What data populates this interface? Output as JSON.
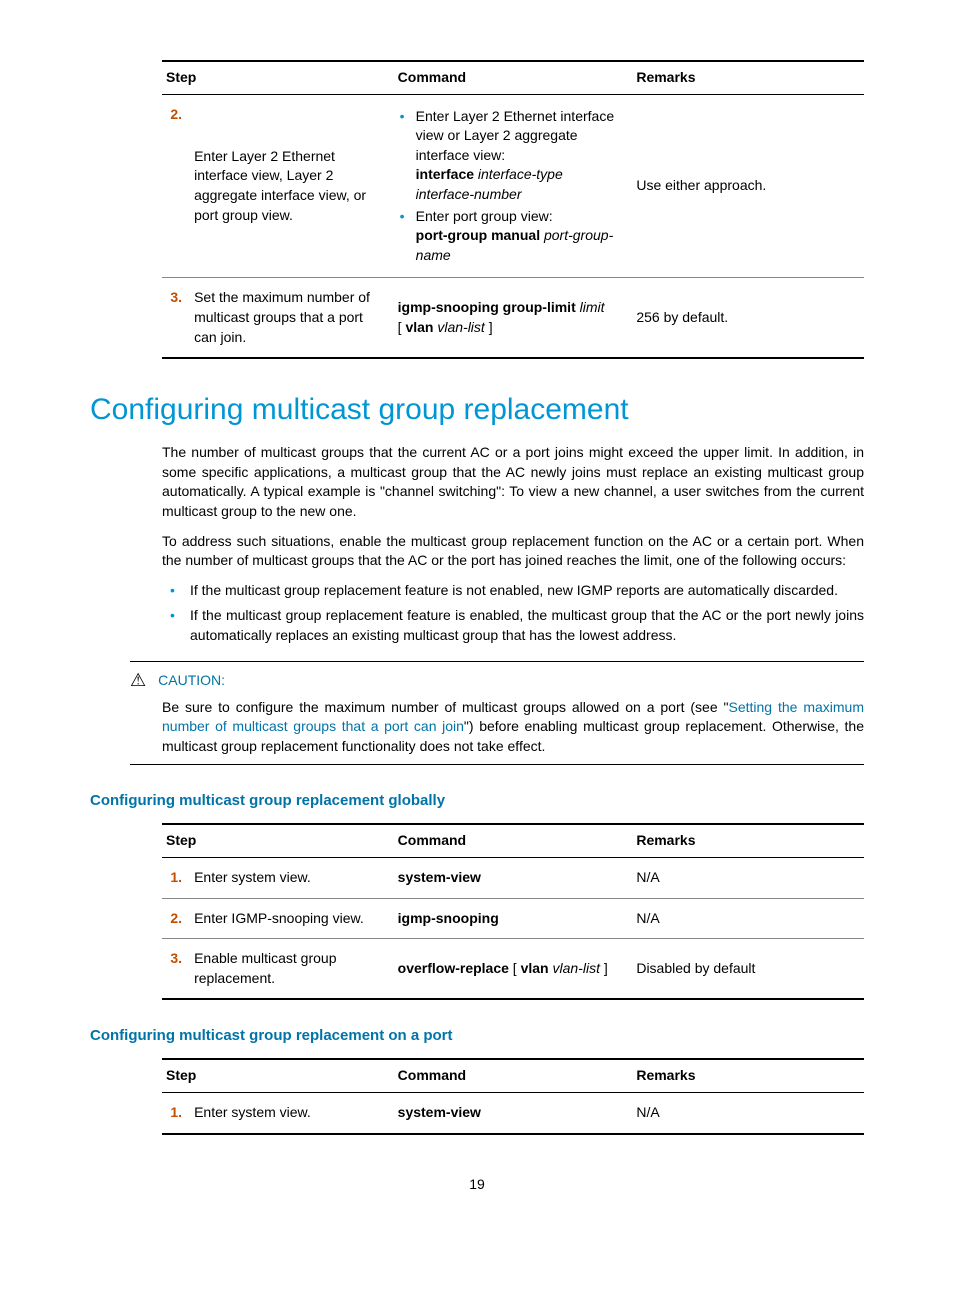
{
  "table1": {
    "headers": {
      "step": "Step",
      "command": "Command",
      "remarks": "Remarks"
    },
    "row2": {
      "num": "2.",
      "step": "Enter Layer 2 Ethernet interface view, Layer 2 aggregate interface view, or port group view.",
      "cmd_a1": "Enter Layer 2 Ethernet interface view or Layer 2 aggregate interface view:",
      "cmd_a2_bold": "interface",
      "cmd_a2_ital": " interface-type interface-number",
      "cmd_b1": "Enter port group view:",
      "cmd_b2_bold": "port-group manual",
      "cmd_b2_ital": " port-group-name",
      "remarks": "Use either approach."
    },
    "row3": {
      "num": "3.",
      "step": "Set the maximum number of multicast groups that a port can join.",
      "cmd_bold1": "igmp-snooping group-limit",
      "cmd_ital1": " limit",
      "cmd_plain2": " [ ",
      "cmd_bold2": "vlan",
      "cmd_ital2": " vlan-list",
      "cmd_plain3": " ]",
      "remarks": "256 by default."
    }
  },
  "h1": "Configuring multicast group replacement",
  "para1": "The number of multicast groups that the current AC or a port joins might exceed the upper limit. In addition, in some specific applications, a multicast group that the AC newly joins must replace an existing multicast group automatically. A typical example is \"channel switching\": To view a new channel, a user switches from the current multicast group to the new one.",
  "para2": "To address such situations, enable the multicast group replacement function on the AC or a certain port. When the number of multicast groups that the AC or the port has joined reaches the limit, one of the following occurs:",
  "bullet1": "If the multicast group replacement feature is not enabled, new IGMP reports are automatically discarded.",
  "bullet2": "If the multicast group replacement feature is enabled, the multicast group that the AC or the port newly joins automatically replaces an existing multicast group that has the lowest address.",
  "caution": {
    "label": "CAUTION:",
    "body_a": "Be sure to configure the maximum number of multicast groups allowed on a port (see \"",
    "link": "Setting the maximum number of multicast groups that a port can join",
    "body_b": "\") before enabling multicast group replacement. Otherwise, the multicast group replacement functionality does not take effect."
  },
  "h3a": "Configuring multicast group replacement globally",
  "table2": {
    "headers": {
      "step": "Step",
      "command": "Command",
      "remarks": "Remarks"
    },
    "row1": {
      "num": "1.",
      "step": "Enter system view.",
      "cmd": "system-view",
      "remarks": "N/A"
    },
    "row2": {
      "num": "2.",
      "step": "Enter IGMP-snooping view.",
      "cmd": "igmp-snooping",
      "remarks": "N/A"
    },
    "row3": {
      "num": "3.",
      "step": "Enable multicast group replacement.",
      "cmd_bold": "overflow-replace",
      "cmd_p1": " [ ",
      "cmd_bold2": "vlan",
      "cmd_ital": " vlan-list",
      "cmd_p2": " ]",
      "remarks": "Disabled by default"
    }
  },
  "h3b": "Configuring multicast group replacement on a port",
  "table3": {
    "headers": {
      "step": "Step",
      "command": "Command",
      "remarks": "Remarks"
    },
    "row1": {
      "num": "1.",
      "step": "Enter system view.",
      "cmd": "system-view",
      "remarks": "N/A"
    }
  },
  "pagenum": "19"
}
